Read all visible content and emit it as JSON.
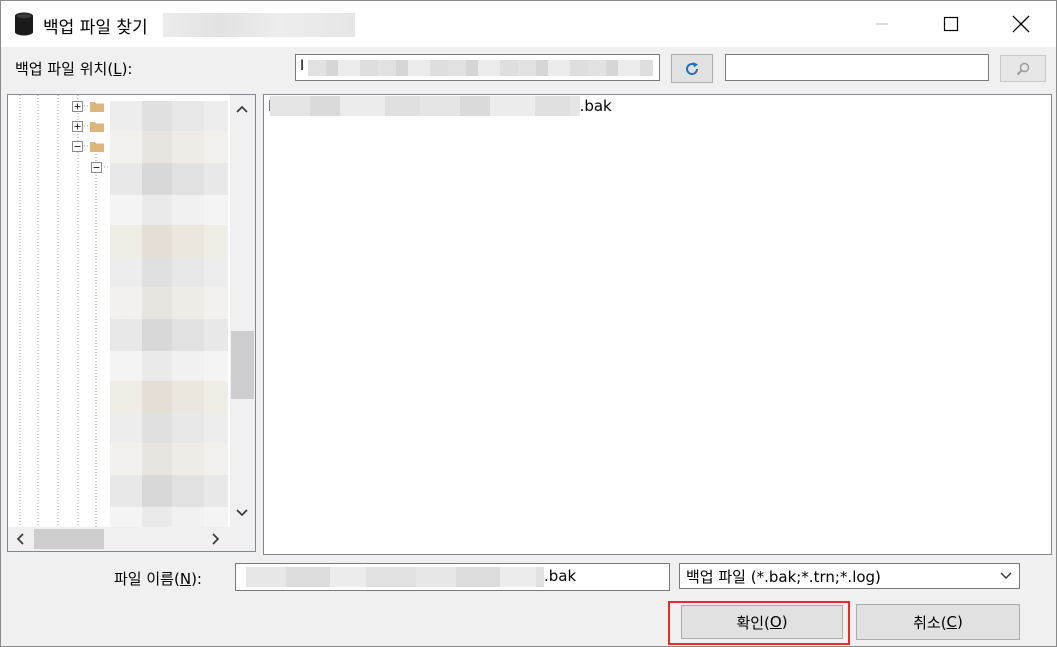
{
  "window": {
    "title": "백업 파일 찾기"
  },
  "location": {
    "label_prefix": "백업 파일 위치(",
    "label_accel": "L",
    "label_suffix": "):",
    "path_value": "I",
    "search_value": ""
  },
  "files": {
    "items": [
      {
        "prefix": "D",
        "suffix": ".bak"
      }
    ]
  },
  "filename": {
    "label_prefix": "파일 이름(",
    "label_accel": "N",
    "label_suffix": "):",
    "value_suffix": ".bak"
  },
  "filetype": {
    "selected": "백업 파일 (*.bak;*.trn;*.log)"
  },
  "buttons": {
    "ok_prefix": "확인(",
    "ok_accel": "O",
    "ok_suffix": ")",
    "cancel_prefix": "취소(",
    "cancel_accel": "C",
    "cancel_suffix": ")"
  },
  "colors": {
    "highlight": "#e52b2b",
    "refresh_icon": "#1e6fc2",
    "folder": "#dcb67a"
  }
}
